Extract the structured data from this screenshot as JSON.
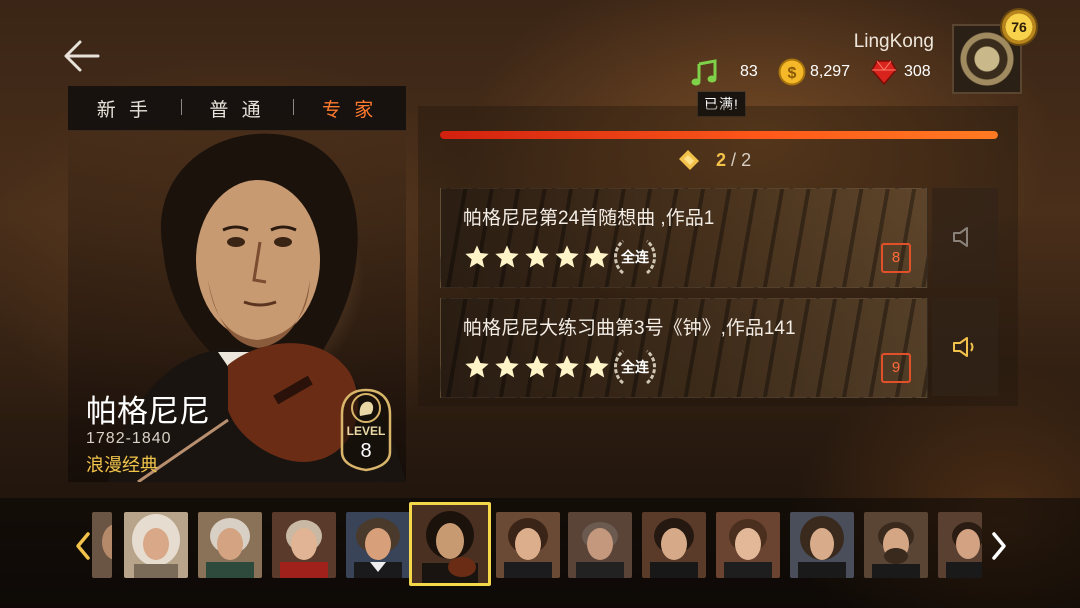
{
  "difficulty_tabs": [
    {
      "label": "新 手",
      "active": false
    },
    {
      "label": "普 通",
      "active": false
    },
    {
      "label": "专 家",
      "active": true
    }
  ],
  "user": {
    "name": "LingKong",
    "level": "76",
    "notes": "83",
    "gold": "8,297",
    "gems": "308",
    "notes_tooltip": "已满!"
  },
  "composer": {
    "name": "帕格尼尼",
    "years": "1782-1840",
    "genre": "浪漫经典",
    "level_label": "LEVEL",
    "level": "8"
  },
  "progress": {
    "fraction": 1.0
  },
  "pagination": {
    "current": "2",
    "separator": "/",
    "total": "2"
  },
  "songs": [
    {
      "title": "帕格尼尼第24首随想曲 ,作品1",
      "stars": 5,
      "full_combo_label": "全连",
      "level": "8",
      "sound_active": false
    },
    {
      "title": "帕格尼尼大练习曲第3号《钟》,作品141",
      "stars": 5,
      "full_combo_label": "全连",
      "level": "9",
      "sound_active": true
    }
  ],
  "composer_strip": [
    {
      "name": "partial-portrait",
      "selected": false
    },
    {
      "name": "handel",
      "selected": false
    },
    {
      "name": "haydn",
      "selected": false
    },
    {
      "name": "mozart",
      "selected": false
    },
    {
      "name": "beethoven",
      "selected": false
    },
    {
      "name": "paganini",
      "selected": true
    },
    {
      "name": "schubert",
      "selected": false
    },
    {
      "name": "glinka",
      "selected": false
    },
    {
      "name": "mendelssohn",
      "selected": false
    },
    {
      "name": "chopin",
      "selected": false
    },
    {
      "name": "liszt",
      "selected": false
    },
    {
      "name": "verdi",
      "selected": false
    },
    {
      "name": "strauss",
      "selected": false
    }
  ],
  "colors": {
    "accent": "#ff7a2e",
    "gold": "#f3c24b",
    "highlight": "#f4d84a",
    "progress": "#ff5a1a"
  }
}
